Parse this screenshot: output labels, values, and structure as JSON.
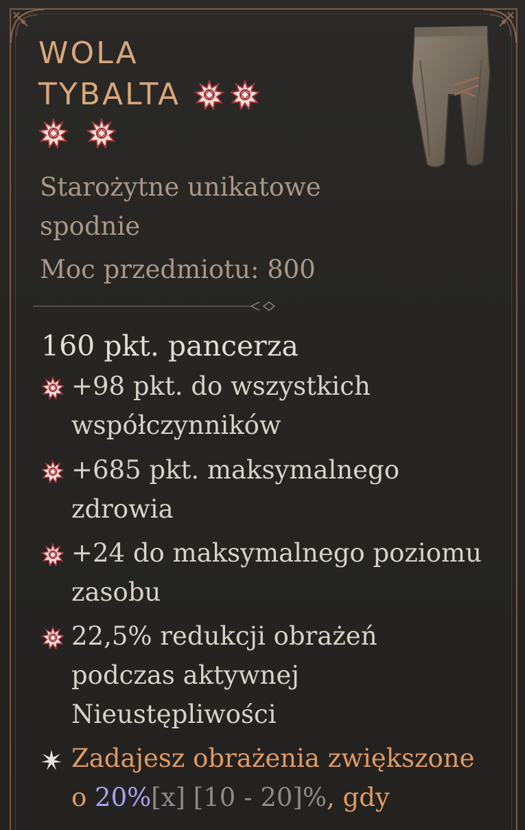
{
  "item": {
    "name": "WOLA TYBALTA",
    "name_line1": "WOLA",
    "name_line2": "TYBALTA",
    "greater_affix_stars": 4,
    "type_line1": "Starożytne unikatowe",
    "type_line2": "spodnie",
    "power_label": "Moc przedmiotu: 800",
    "armor": "160 pkt. pancerza"
  },
  "affixes": [
    {
      "line1": "+98 pkt. do wszystkich",
      "line2": "współczynników"
    },
    {
      "line1": "+685 pkt. maksymalnego",
      "line2": "zdrowia"
    },
    {
      "line1": "+24 do maksymalnego poziomu",
      "line2": "zasobu"
    },
    {
      "line1": "22,5% redukcji obrażeń",
      "line2": "podczas aktywnej",
      "line3": "Nieustępliwości"
    }
  ],
  "unique_power": {
    "line1": "Zadajesz obrażenia zwiększone",
    "line2_prefix": "o ",
    "value": "20%",
    "value_tag": "[x]",
    "range": " [10 - 20]%",
    "line2_suffix": ", gdy"
  },
  "colors": {
    "frame": "#7b5a46",
    "title": "#d9a77a",
    "subtitle": "#a89888",
    "affix_text": "#d8d2ca",
    "unique_text": "#e09a62",
    "value_highlight": "#a9a2f2",
    "star_fill": "#f3dfd8",
    "star_outline": "#a8333a"
  },
  "icons": {
    "greater_affix": "greater-affix-star-icon",
    "affix_bullet": "affix-bullet-icon",
    "unique_bullet": "unique-power-bullet-icon",
    "item": "pants-item-icon"
  }
}
